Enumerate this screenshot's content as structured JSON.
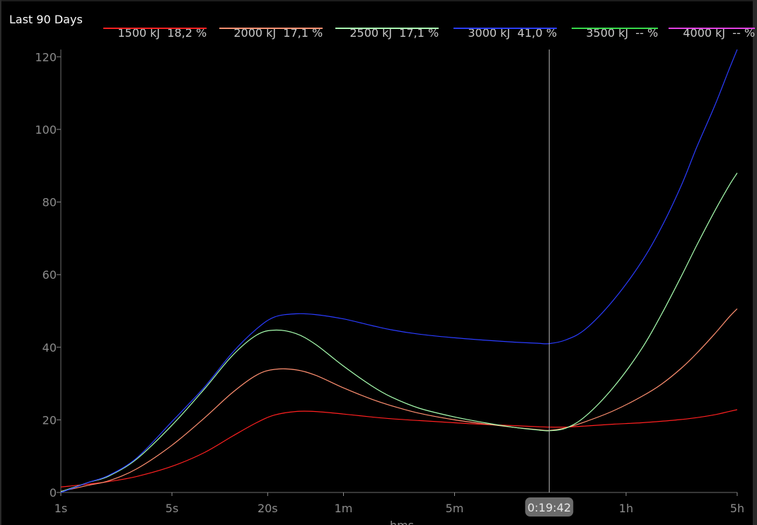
{
  "legend": {
    "period": "Last 90 Days",
    "items": [
      {
        "label": "1500 kJ  18,2 %",
        "color": "#ff2020"
      },
      {
        "label": "2000 kJ  17,1 %",
        "color": "#ff8f70"
      },
      {
        "label": "2500 kJ  17,1 %",
        "color": "#a8ffb0"
      },
      {
        "label": "3000 kJ  41,0 %",
        "color": "#2a3cff"
      },
      {
        "label": "3500 kJ  -- %",
        "color": "#37d84a"
      },
      {
        "label": "4000 kJ  -- %",
        "color": "#e040e0"
      }
    ]
  },
  "cursor": {
    "label": "0:19:42",
    "seconds": 1182
  },
  "chart_data": {
    "type": "line",
    "title": "",
    "xlabel": "hms",
    "ylabel": "",
    "x_scale": "log",
    "x_ticks": [
      {
        "label": "1s",
        "seconds": 1
      },
      {
        "label": "5s",
        "seconds": 5
      },
      {
        "label": "20s",
        "seconds": 20
      },
      {
        "label": "1m",
        "seconds": 60
      },
      {
        "label": "5m",
        "seconds": 300
      },
      {
        "label": "1h",
        "seconds": 3600
      },
      {
        "label": "5h",
        "seconds": 18000
      }
    ],
    "ylim": [
      0,
      122
    ],
    "y_ticks": [
      0,
      20,
      40,
      60,
      80,
      100,
      120
    ],
    "grid": false,
    "legend_position": "top",
    "x_seconds": [
      1,
      1.5,
      2,
      3,
      5,
      8,
      12,
      17,
      22,
      30,
      40,
      60,
      90,
      120,
      180,
      300,
      480,
      720,
      1000,
      1182,
      1500,
      2000,
      3000,
      4500,
      6000,
      8000,
      10000,
      13000,
      16000,
      18000
    ],
    "series": [
      {
        "name": "1500 kJ  18,2 %",
        "color": "#ff2020",
        "values": [
          1.5,
          2.3,
          3,
          4.4,
          7.2,
          11,
          15.5,
          19.2,
          21.3,
          22.3,
          22.3,
          21.6,
          20.8,
          20.3,
          19.8,
          19.2,
          18.7,
          18.4,
          18.1,
          18.0,
          18.0,
          18.3,
          18.8,
          19.2,
          19.6,
          20.1,
          20.6,
          21.4,
          22.3,
          22.8
        ]
      },
      {
        "name": "2000 kJ  17,1 %",
        "color": "#ff8f70",
        "values": [
          0.3,
          2.0,
          3.2,
          6.5,
          13,
          20.5,
          27.5,
          32.3,
          33.9,
          33.8,
          32.3,
          28.8,
          25.7,
          23.9,
          21.8,
          20.0,
          18.8,
          17.9,
          17.3,
          17.1,
          17.8,
          19.5,
          22.5,
          26.4,
          29.8,
          34.2,
          38.3,
          43.7,
          48.3,
          50.6
        ]
      },
      {
        "name": "2500 kJ  17,1 %",
        "color": "#a8ffb0",
        "values": [
          0.2,
          2.8,
          4.5,
          9.2,
          18.5,
          28.5,
          37.7,
          43.3,
          44.7,
          43.8,
          40.8,
          34.8,
          29.4,
          26.3,
          23.2,
          20.8,
          19.1,
          17.9,
          17.2,
          17.0,
          17.7,
          21.0,
          29.0,
          39.5,
          49.0,
          59.5,
          68.0,
          77.5,
          84.5,
          88.0
        ]
      },
      {
        "name": "3000 kJ  41,0 %",
        "color": "#2a3cff",
        "values": [
          0,
          2.8,
          4.7,
          9.5,
          19.5,
          29.0,
          38.5,
          45.0,
          48.3,
          49.2,
          49.0,
          47.8,
          46.0,
          44.8,
          43.6,
          42.6,
          41.9,
          41.4,
          41.1,
          41.0,
          42.0,
          45.0,
          53.0,
          63.5,
          73.0,
          84.5,
          95.0,
          106.5,
          116.5,
          122.0
        ]
      }
    ]
  }
}
